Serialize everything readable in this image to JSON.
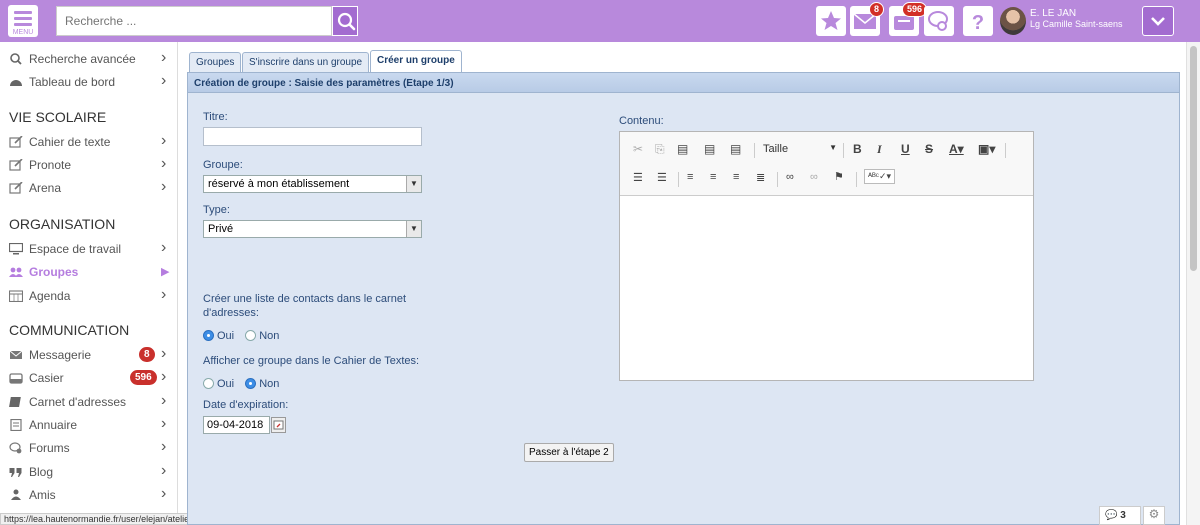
{
  "topbar": {
    "menu_label": "MENU",
    "search_placeholder": "Recherche ...",
    "messages_badge": "8",
    "locker_badge": "596",
    "user_name": "E. LE JAN",
    "user_school": "Lg Camille Saint-saens"
  },
  "sidebar": {
    "items_top": [
      {
        "label": "Recherche avancée",
        "icon": "search-icon"
      },
      {
        "label": "Tableau de bord",
        "icon": "dashboard-icon"
      }
    ],
    "section_vie": "VIE SCOLAIRE",
    "vie_items": [
      {
        "label": "Cahier de texte",
        "icon": "edit-icon"
      },
      {
        "label": "Pronote",
        "icon": "edit-icon"
      },
      {
        "label": "Arena",
        "icon": "edit-icon"
      }
    ],
    "section_org": "ORGANISATION",
    "org_items": [
      {
        "label": "Espace de travail",
        "icon": "monitor-icon"
      },
      {
        "label": "Groupes",
        "icon": "users-icon"
      },
      {
        "label": "Agenda",
        "icon": "calendar-icon"
      }
    ],
    "section_comm": "COMMUNICATION",
    "comm_items": [
      {
        "label": "Messagerie",
        "icon": "mail-icon",
        "badge": "8"
      },
      {
        "label": "Casier",
        "icon": "inbox-icon",
        "badge": "596"
      },
      {
        "label": "Carnet d'adresses",
        "icon": "book-icon"
      },
      {
        "label": "Annuaire",
        "icon": "directory-icon"
      },
      {
        "label": "Forums",
        "icon": "forum-icon"
      },
      {
        "label": "Blog",
        "icon": "quote-icon"
      },
      {
        "label": "Amis",
        "icon": "friends-icon"
      }
    ],
    "status_url": "https://lea.hautenormandie.fr/user/elejan/ateliers#"
  },
  "tabs": [
    "Groupes",
    "S'inscrire dans un groupe",
    "Créer un groupe"
  ],
  "panel": {
    "title": "Création de groupe : Saisie des paramètres (Etape 1/3)",
    "titre_label": "Titre:",
    "titre_value": "",
    "groupe_label": "Groupe:",
    "groupe_value": "réservé à mon établissement",
    "type_label": "Type:",
    "type_value": "Privé",
    "contacts_label": "Créer une liste de contacts dans le carnet d'adresses:",
    "cahier_label": "Afficher ce groupe dans le Cahier de Textes:",
    "oui": "Oui",
    "non": "Non",
    "date_label": "Date d'expiration:",
    "date_value": "09-04-2018",
    "next_button": "Passer à l'étape 2",
    "contenu_label": "Contenu:",
    "taille_label": "Taille"
  },
  "footer": {
    "chat_count": "3"
  },
  "colors": {
    "brand": "#b889dc",
    "panel_bg": "#dde6f3",
    "badge": "#c9302c"
  }
}
